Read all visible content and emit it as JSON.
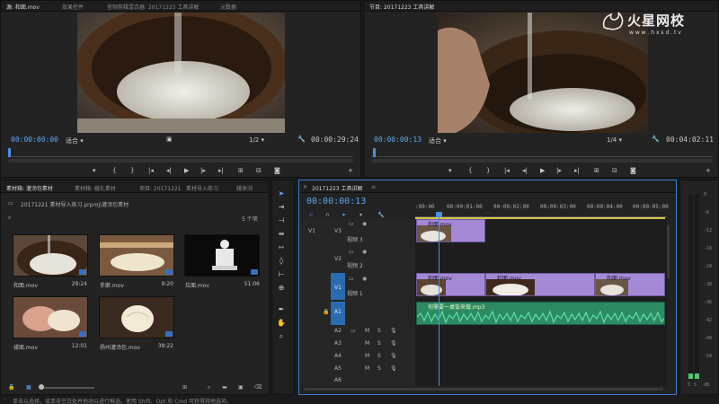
{
  "source_monitor": {
    "tabs": [
      "源: 和面.mov",
      "效果控件",
      "音频剪辑混合器: 20171223  工具讲解",
      "元数据"
    ],
    "timecode_in": "00:00:00:00",
    "fit": "适合",
    "resolution": "1/2",
    "timecode_duration": "00:00:29:24"
  },
  "program_monitor": {
    "tab": "节目: 20171223  工具讲解",
    "timecode_in": "00:00:00:13",
    "fit": "适合",
    "resolution": "1/4",
    "timecode_duration": "00:04:02:11"
  },
  "watermark": {
    "brand": "火星网校",
    "url": "w w w . h x s d . t v"
  },
  "project_panel": {
    "tabs": [
      "素材箱: 灌汤包素材",
      "素材箱: 婚礼素材",
      "项目: 20171221",
      "素材导入练习",
      "媒体浏"
    ],
    "bin_path": "20171221  素材导入练习.prproj\\灌汤包素材",
    "item_count": "5 个项",
    "items": [
      {
        "name": "和面.mov",
        "duration": "29:24"
      },
      {
        "name": "手擀.mov",
        "duration": "9:20"
      },
      {
        "name": "拉面.mov",
        "duration": "51:06"
      },
      {
        "name": "揉面.mov",
        "duration": "12:01"
      },
      {
        "name": "扬州灌汤包.mov",
        "duration": "38:22"
      }
    ]
  },
  "timeline": {
    "tab": "20171223  工具讲解",
    "timecode": "00:00:00:13",
    "ruler": [
      ":00:00",
      "00:00:01:00",
      "00:00:02:00",
      "00:00:03:00",
      "00:00:04:00",
      "00:00:05:00"
    ],
    "video_tracks": [
      {
        "id": "V3",
        "name": "视频 3"
      },
      {
        "id": "V2",
        "name": "视频 2"
      },
      {
        "id": "V1",
        "name": "视频 1"
      }
    ],
    "audio_tracks": [
      "A1",
      "A2",
      "A3",
      "A4",
      "A5",
      "A6"
    ],
    "clips": {
      "v3": "和面.mov",
      "v1_a": "和面.mov",
      "v1_b": "和面.mov",
      "v1_c": "和面.mov",
      "a1": "何需要一桌饭来做.mp3"
    }
  },
  "meter_labels": [
    "0",
    "-6",
    "-12",
    "-18",
    "-24",
    "-30",
    "-36",
    "-42",
    "-48",
    "-54",
    "dB"
  ],
  "status_bar": "单击以选择，或单击空白处并拖动以进行框选。使用 Shift、Opt 和 Cmd 可获得其他选项。",
  "colors": {
    "timecode_blue": "#5da6f0",
    "clip_purple": "#a689d6",
    "audio_green": "#3fae7e",
    "track_blue": "#2b6cb0",
    "playhead": "#4a8fe0",
    "work_area_yellow": "#d6c84a"
  }
}
